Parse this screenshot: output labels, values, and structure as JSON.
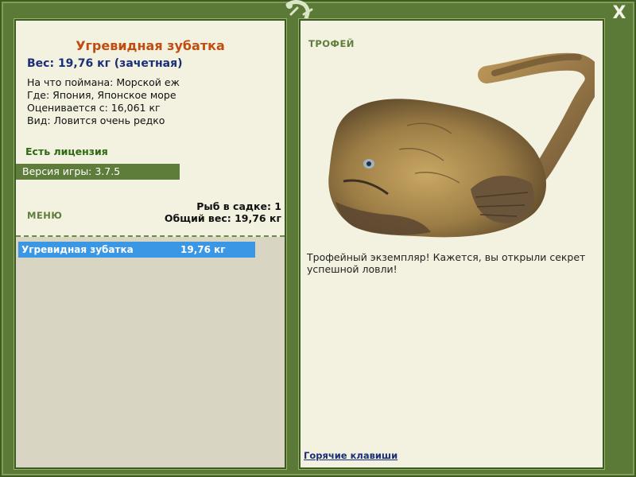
{
  "window": {
    "close_label": "X"
  },
  "fish": {
    "name": "Угревидная зубатка",
    "weight_line": "Вес: 19,76 кг (зачетная)",
    "details": [
      "На что поймана: Морской еж",
      "Где: Япония, Японское море",
      "Оценивается с: 16,061 кг",
      "Вид: Ловится очень редко"
    ]
  },
  "license": "Есть лицензия",
  "version": "Версия игры: 3.7.5",
  "menu_label": "МЕНЮ",
  "keep": {
    "count_line": "Рыб в садке: 1",
    "total_line": "Общий вес: 19,76 кг",
    "rows": [
      {
        "name": "Угревидная зубатка",
        "weight": "19,76 кг"
      }
    ]
  },
  "trophy": {
    "label": "ТРОФЕЙ",
    "message": "Трофейный экземпляр! Кажется, вы открыли секрет успешной ловли!"
  },
  "hotkeys_label": "Горячие клавиши",
  "colors": {
    "frame": "#5b7a37",
    "panel": "#f3f1e0",
    "title": "#c04d10",
    "weight": "#1a2f78",
    "license": "#2e6a12",
    "selected_row": "#3a97e6"
  }
}
